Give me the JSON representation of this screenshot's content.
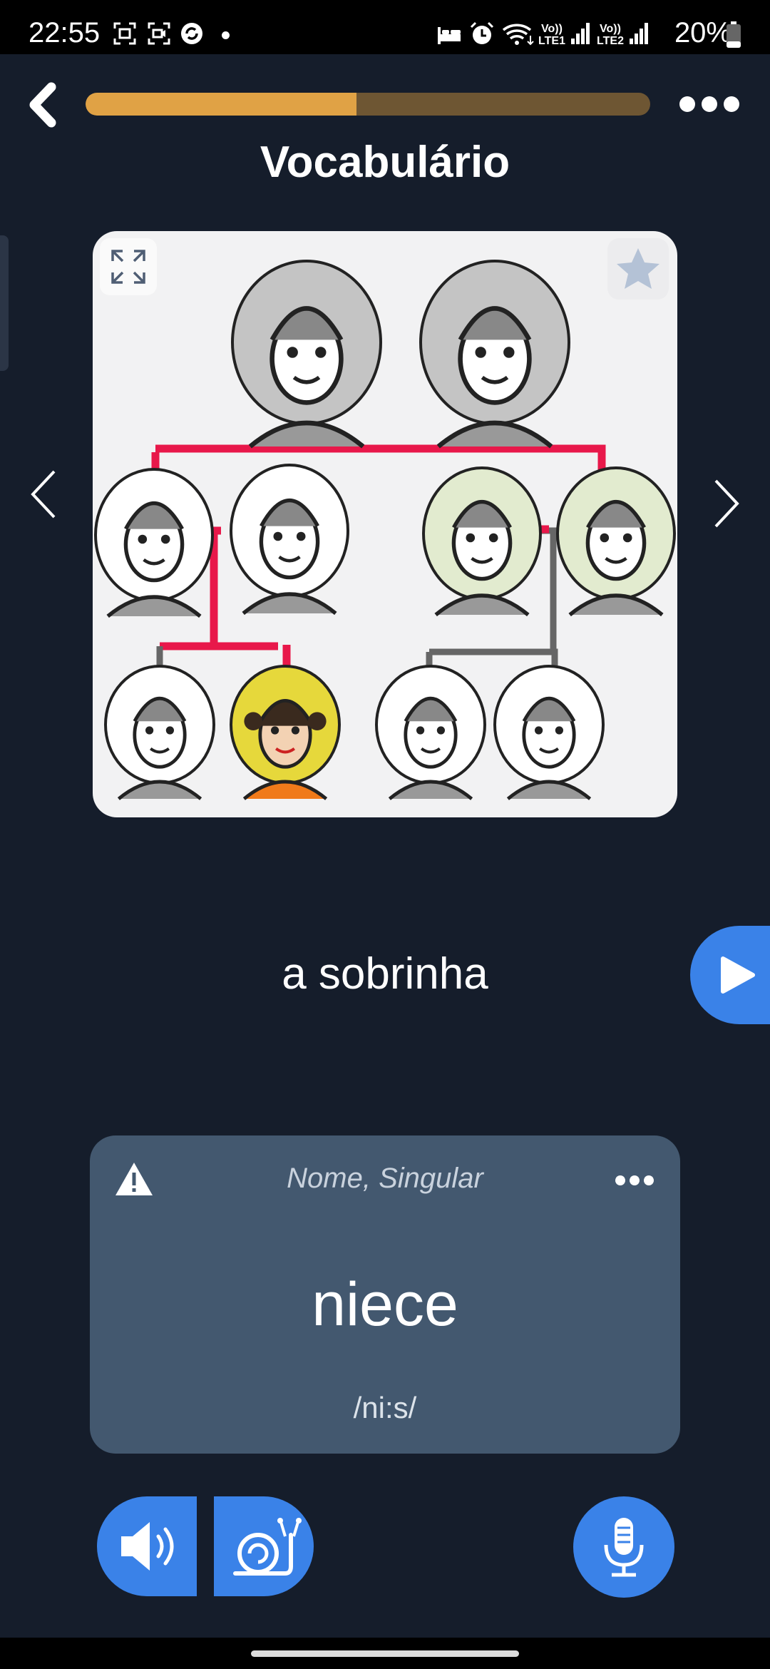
{
  "status_bar": {
    "time": "22:55",
    "battery": "20%",
    "sim1": "Vo)) LTE1",
    "sim2": "Vo)) LTE2",
    "icons": [
      "screenshot-icon",
      "screen-record-icon",
      "sync-app-icon",
      "dot-icon",
      "sleep-mode-icon",
      "alarm-icon",
      "wifi-icon",
      "signal-icon",
      "battery-icon"
    ]
  },
  "header": {
    "title": "Vocabulário",
    "progress": 0.48,
    "colors": {
      "progress_fill": "#e0a245",
      "progress_track": "#6e5633"
    }
  },
  "flashcard": {
    "image_alt": "family-tree-illustration",
    "word": "a sobrinha"
  },
  "translation_card": {
    "word_class": "Nome, Singular",
    "translation": "niece",
    "pronunciation": "/ni:s/"
  },
  "colors": {
    "background": "#151d2b",
    "accent_blue": "#3a82e8",
    "card": "#43586f",
    "highlight_red": "#e8184a",
    "highlight_yellow": "#e6d83b"
  }
}
